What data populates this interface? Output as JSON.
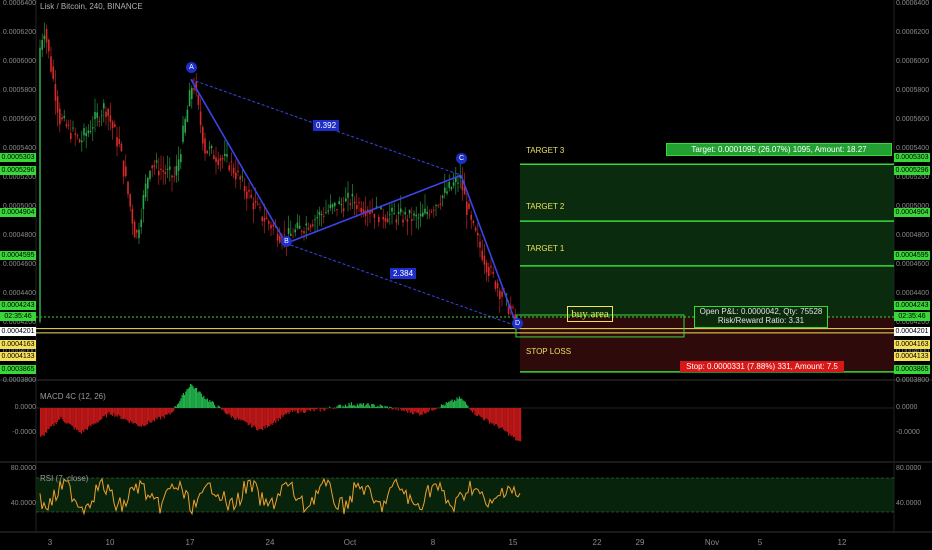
{
  "header": {
    "symbol_line": "Lisk / Bitcoin, 240, BINANCE"
  },
  "colors": {
    "up": "#2ca84a",
    "down": "#d92a2a",
    "pattern": "#3a44e8",
    "target": "#38d838",
    "stop": "#e01b1b",
    "buy": "#f5e05a",
    "rsi": "#f0a030",
    "macd_pos": "#22b04a",
    "macd_neg": "#c01818"
  },
  "chart_data": {
    "type": "candlestick",
    "title": "Lisk / Bitcoin, 240, BINANCE",
    "x_ticks": [
      "3",
      "10",
      "17",
      "24",
      "Oct",
      "8",
      "15",
      "22",
      "29",
      "Nov",
      "5",
      "12"
    ],
    "y_ticks_right": [
      "0.0006400",
      "0.0006200",
      "0.0006000",
      "0.0005800",
      "0.0005600",
      "0.0005400",
      "0.0005200",
      "0.0005000",
      "0.0004800",
      "0.0004600",
      "0.0004400",
      "0.0004200",
      "0.0004000",
      "0.0003800"
    ],
    "y_ticks_left": [
      "0.0006400",
      "0.0006200",
      "0.0006000",
      "0.0005800",
      "0.0005600",
      "0.0005400",
      "0.0005200",
      "0.0005000",
      "0.0004800",
      "0.0004600",
      "0.0004400",
      "0.0004200",
      "0.0004000",
      "0.0003800"
    ],
    "ylim": [
      0.000385,
      0.00064
    ],
    "price_tags": [
      {
        "label": "0.0005303",
        "color": "#38d838"
      },
      {
        "label": "0.0005296",
        "color": "#38d838"
      },
      {
        "label": "0.0004904",
        "color": "#38d838"
      },
      {
        "label": "0.0004595",
        "color": "#38d838"
      },
      {
        "label": "0.0004243",
        "color": "#38d838"
      },
      {
        "label": "02:35:46",
        "color": "#38d838"
      },
      {
        "label": "0.0004201",
        "color": "#ffffff"
      },
      {
        "label": "0.0004163",
        "color": "#f5e05a"
      },
      {
        "label": "0.0004133",
        "color": "#f5e05a"
      },
      {
        "label": "0.0003865",
        "color": "#38d838"
      }
    ],
    "left_tags": [
      {
        "label": "0.0005303",
        "color": "#38d838"
      },
      {
        "label": "0.0005296",
        "color": "#38d838"
      },
      {
        "label": "0.0004904",
        "color": "#38d838"
      },
      {
        "label": "0.0004595",
        "color": "#38d838"
      },
      {
        "label": "0.0004243",
        "color": "#38d838"
      },
      {
        "label": "02:35:46",
        "color": "#38d838"
      },
      {
        "label": "0.0004201",
        "color": "#ffffff"
      },
      {
        "label": "0.0004163",
        "color": "#f5e05a"
      },
      {
        "label": "0.0004133",
        "color": "#f5e05a"
      },
      {
        "label": "0.0003865",
        "color": "#38d838"
      }
    ],
    "pattern_points": [
      {
        "label": "A",
        "price": 0.000588
      },
      {
        "label": "B",
        "price": 0.000475
      },
      {
        "label": "C",
        "price": 0.000522
      },
      {
        "label": "D",
        "price": 0.000418
      }
    ],
    "ratios": [
      "0.392",
      "2.384"
    ],
    "levels": [
      {
        "label": "TARGET 3",
        "price": 0.0005296
      },
      {
        "label": "TARGET 2",
        "price": 0.0004904
      },
      {
        "label": "TARGET 1",
        "price": 0.0004595
      },
      {
        "label": "STOP LOSS",
        "price": 0.0003865
      }
    ],
    "buy_area_label": "buy area",
    "target_box": "Target: 0.0001095 (26.07%) 1095, Amount: 18.27",
    "stop_box": "Stop: 0.0000331 (7.88%) 331, Amount: 7.5",
    "pnl_line1": "Open P&L: 0.0000042, Qty: 75528",
    "pnl_line2": "Risk/Reward Ratio: 3.31",
    "macd": {
      "label": "MACD 4C (12, 26)",
      "ticks_left": [
        "0.0000",
        "-0.0000"
      ],
      "ticks_right": [
        "0.0000",
        "-0.0000"
      ]
    },
    "rsi": {
      "label": "RSI (7, close)",
      "ticks_left": [
        "80.0000",
        "40.0000"
      ],
      "ticks_right": [
        "80.0000",
        "40.0000"
      ]
    }
  }
}
